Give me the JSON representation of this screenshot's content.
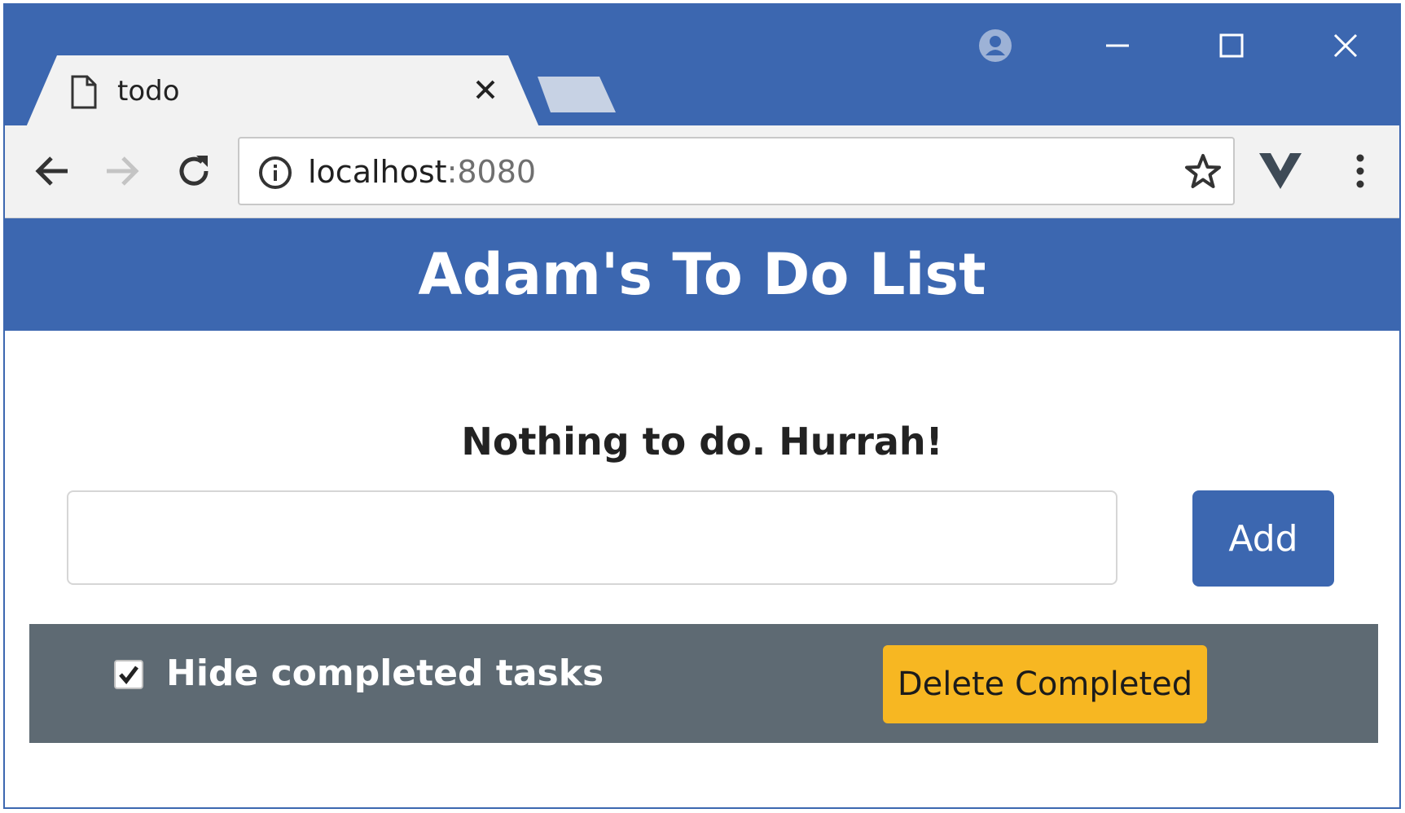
{
  "browser": {
    "tab": {
      "title": "todo"
    },
    "address_bar": {
      "host": "localhost",
      "port": ":8080"
    }
  },
  "app": {
    "title": "Adam's To Do List",
    "empty_message": "Nothing to do. Hurrah!",
    "new_task_input": {
      "value": "",
      "placeholder": ""
    },
    "add_button_label": "Add",
    "hide_completed": {
      "label": "Hide completed tasks",
      "checked": true
    },
    "delete_completed_label": "Delete Completed"
  },
  "colors": {
    "brand_blue": "#3c67b0",
    "footer_gray": "#5e6a73",
    "warning_yellow": "#f7b722"
  }
}
